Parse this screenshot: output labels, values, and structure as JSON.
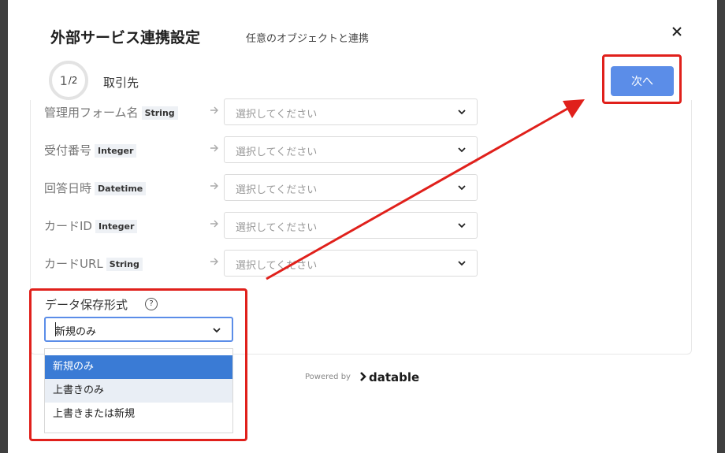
{
  "modal": {
    "title": "外部サービス連携設定",
    "subtitle": "任意のオブジェクトと連携",
    "step_current": "1",
    "step_total": "/2",
    "step_name": "取引先",
    "next_label": "次へ"
  },
  "fields": [
    {
      "label": "管理用フォーム名",
      "type": "String",
      "placeholder": "選択してください"
    },
    {
      "label": "受付番号",
      "type": "Integer",
      "placeholder": "選択してください"
    },
    {
      "label": "回答日時",
      "type": "Datetime",
      "placeholder": "選択してください"
    },
    {
      "label": "カードID",
      "type": "Integer",
      "placeholder": "選択してください"
    },
    {
      "label": "カードURL",
      "type": "String",
      "placeholder": "選択してください"
    }
  ],
  "save_format": {
    "label": "データ保存形式",
    "help": "?",
    "value": "新規のみ",
    "options": [
      "新規のみ",
      "上書きのみ",
      "上書きまたは新規"
    ]
  },
  "footer": {
    "powered_by": "Powered by",
    "brand": "datable"
  },
  "colors": {
    "accent": "#5b8de8",
    "selected_option": "#3a7bd5",
    "annotation_red": "#e0201b"
  }
}
